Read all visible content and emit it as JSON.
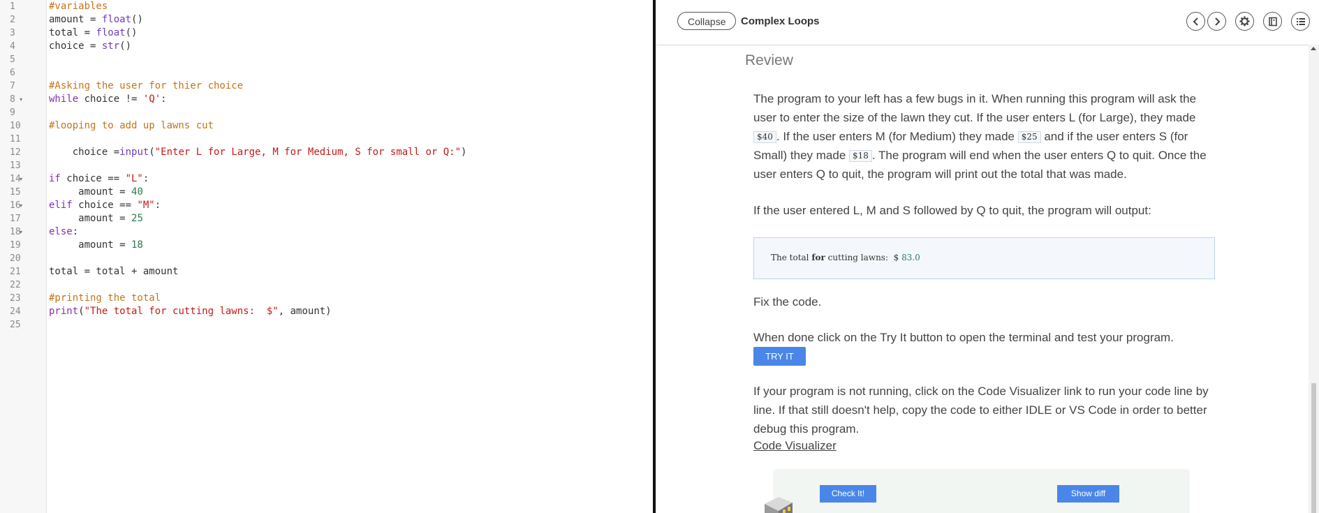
{
  "editor": {
    "lines": [
      {
        "n": "1",
        "fold": false,
        "indent": "",
        "tokens": [
          {
            "t": "#variables",
            "c": "comment"
          }
        ]
      },
      {
        "n": "2",
        "fold": false,
        "indent": "",
        "tokens": [
          {
            "t": "amount = ",
            "c": "pl"
          },
          {
            "t": "float",
            "c": "bi"
          },
          {
            "t": "()",
            "c": "pl"
          }
        ]
      },
      {
        "n": "3",
        "fold": false,
        "indent": "",
        "tokens": [
          {
            "t": "total = ",
            "c": "pl"
          },
          {
            "t": "float",
            "c": "bi"
          },
          {
            "t": "()",
            "c": "pl"
          }
        ]
      },
      {
        "n": "4",
        "fold": false,
        "indent": "",
        "tokens": [
          {
            "t": "choice = ",
            "c": "pl"
          },
          {
            "t": "str",
            "c": "bi"
          },
          {
            "t": "()",
            "c": "pl"
          }
        ]
      },
      {
        "n": "5",
        "fold": false,
        "indent": "",
        "tokens": []
      },
      {
        "n": "6",
        "fold": false,
        "indent": "",
        "tokens": []
      },
      {
        "n": "7",
        "fold": false,
        "indent": "",
        "tokens": [
          {
            "t": "#Asking the user for thier choice",
            "c": "comment"
          }
        ]
      },
      {
        "n": "8",
        "fold": true,
        "indent": "",
        "tokens": [
          {
            "t": "while",
            "c": "kw"
          },
          {
            "t": " choice != ",
            "c": "pl"
          },
          {
            "t": "'Q'",
            "c": "str"
          },
          {
            "t": ":",
            "c": "pl"
          }
        ]
      },
      {
        "n": "9",
        "fold": false,
        "indent": "",
        "tokens": []
      },
      {
        "n": "10",
        "fold": false,
        "indent": "",
        "tokens": [
          {
            "t": "#looping to add up lawns cut",
            "c": "comment"
          }
        ]
      },
      {
        "n": "11",
        "fold": false,
        "indent": "",
        "tokens": []
      },
      {
        "n": "12",
        "fold": false,
        "indent": "    ",
        "tokens": [
          {
            "t": "choice =",
            "c": "pl"
          },
          {
            "t": "input",
            "c": "bi"
          },
          {
            "t": "(",
            "c": "pl"
          },
          {
            "t": "\"Enter L for Large, M for Medium, S for small or Q:\"",
            "c": "str"
          },
          {
            "t": ")",
            "c": "pl"
          }
        ]
      },
      {
        "n": "13",
        "fold": false,
        "indent": "",
        "tokens": []
      },
      {
        "n": "14",
        "fold": true,
        "indent": "",
        "tokens": [
          {
            "t": "if",
            "c": "kw"
          },
          {
            "t": " choice == ",
            "c": "pl"
          },
          {
            "t": "\"L\"",
            "c": "str"
          },
          {
            "t": ":",
            "c": "pl"
          }
        ]
      },
      {
        "n": "15",
        "fold": false,
        "indent": "     ",
        "tokens": [
          {
            "t": "amount = ",
            "c": "pl"
          },
          {
            "t": "40",
            "c": "num"
          }
        ]
      },
      {
        "n": "16",
        "fold": true,
        "indent": "",
        "tokens": [
          {
            "t": "elif",
            "c": "kw"
          },
          {
            "t": " choice == ",
            "c": "pl"
          },
          {
            "t": "\"M\"",
            "c": "str"
          },
          {
            "t": ":",
            "c": "pl"
          }
        ]
      },
      {
        "n": "17",
        "fold": false,
        "indent": "     ",
        "tokens": [
          {
            "t": "amount = ",
            "c": "pl"
          },
          {
            "t": "25",
            "c": "num"
          }
        ]
      },
      {
        "n": "18",
        "fold": true,
        "indent": "",
        "tokens": [
          {
            "t": "else",
            "c": "kw"
          },
          {
            "t": ":",
            "c": "pl"
          }
        ]
      },
      {
        "n": "19",
        "fold": false,
        "indent": "     ",
        "tokens": [
          {
            "t": "amount = ",
            "c": "pl"
          },
          {
            "t": "18",
            "c": "num"
          }
        ]
      },
      {
        "n": "20",
        "fold": false,
        "indent": "",
        "tokens": []
      },
      {
        "n": "21",
        "fold": false,
        "indent": "",
        "tokens": [
          {
            "t": "total = total + amount",
            "c": "pl"
          }
        ]
      },
      {
        "n": "22",
        "fold": false,
        "indent": "",
        "tokens": []
      },
      {
        "n": "23",
        "fold": false,
        "indent": "",
        "tokens": [
          {
            "t": "#printing the total",
            "c": "comment"
          }
        ]
      },
      {
        "n": "24",
        "fold": false,
        "indent": "",
        "tokens": [
          {
            "t": "print",
            "c": "kw"
          },
          {
            "t": "(",
            "c": "pl"
          },
          {
            "t": "\"The total for cutting lawns:  $\"",
            "c": "str"
          },
          {
            "t": ", amount)",
            "c": "pl"
          }
        ]
      },
      {
        "n": "25",
        "fold": false,
        "indent": "",
        "tokens": []
      }
    ]
  },
  "guide": {
    "collapse_label": "Collapse",
    "title": "Complex Loops",
    "heading": "Review",
    "intro": {
      "p1": "The program to your left has a few bugs in it. When running this program will ask the user to enter the size of the lawn they cut. If the user enters L (for Large), they made ",
      "price_large": "$40",
      "p2": ". If the user enters M (for Medium) they made ",
      "price_medium": "$25",
      "p3": " and if the user enters S (for Small) they made ",
      "price_small": "$18",
      "p4": ". The program will end when the user enters Q to quit. Once the user enters Q to quit, the program will print out the total that was made."
    },
    "output_intro": "If the user entered L, M and S followed by Q to quit, the program will output:",
    "output": {
      "prefix": "The total ",
      "keyword": "for",
      "middle": " cutting lawns:  $ ",
      "value": "83.0"
    },
    "fix": "Fix the code.",
    "try_intro": "When done click on the Try It button to open the terminal and test your program.",
    "try_label": "TRY IT",
    "visualizer_text": "If your program is not running, click on the Code Visualizer link to run your code line by line. If that still doesn't help, copy the code to either IDLE or VS Code in order to better debug this program.",
    "visualizer_link": "Code Visualizer",
    "check_label": "Check It!",
    "diff_label": "Show diff"
  },
  "colors": {
    "comment": "#c5751a",
    "keyword": "#8b2bb3",
    "string": "#c41a16",
    "number": "#2a7a4b",
    "button": "#4a86e8"
  },
  "icons": [
    "chevron-left-icon",
    "chevron-right-icon",
    "gear-icon",
    "book-icon",
    "list-icon",
    "robot-icon"
  ]
}
